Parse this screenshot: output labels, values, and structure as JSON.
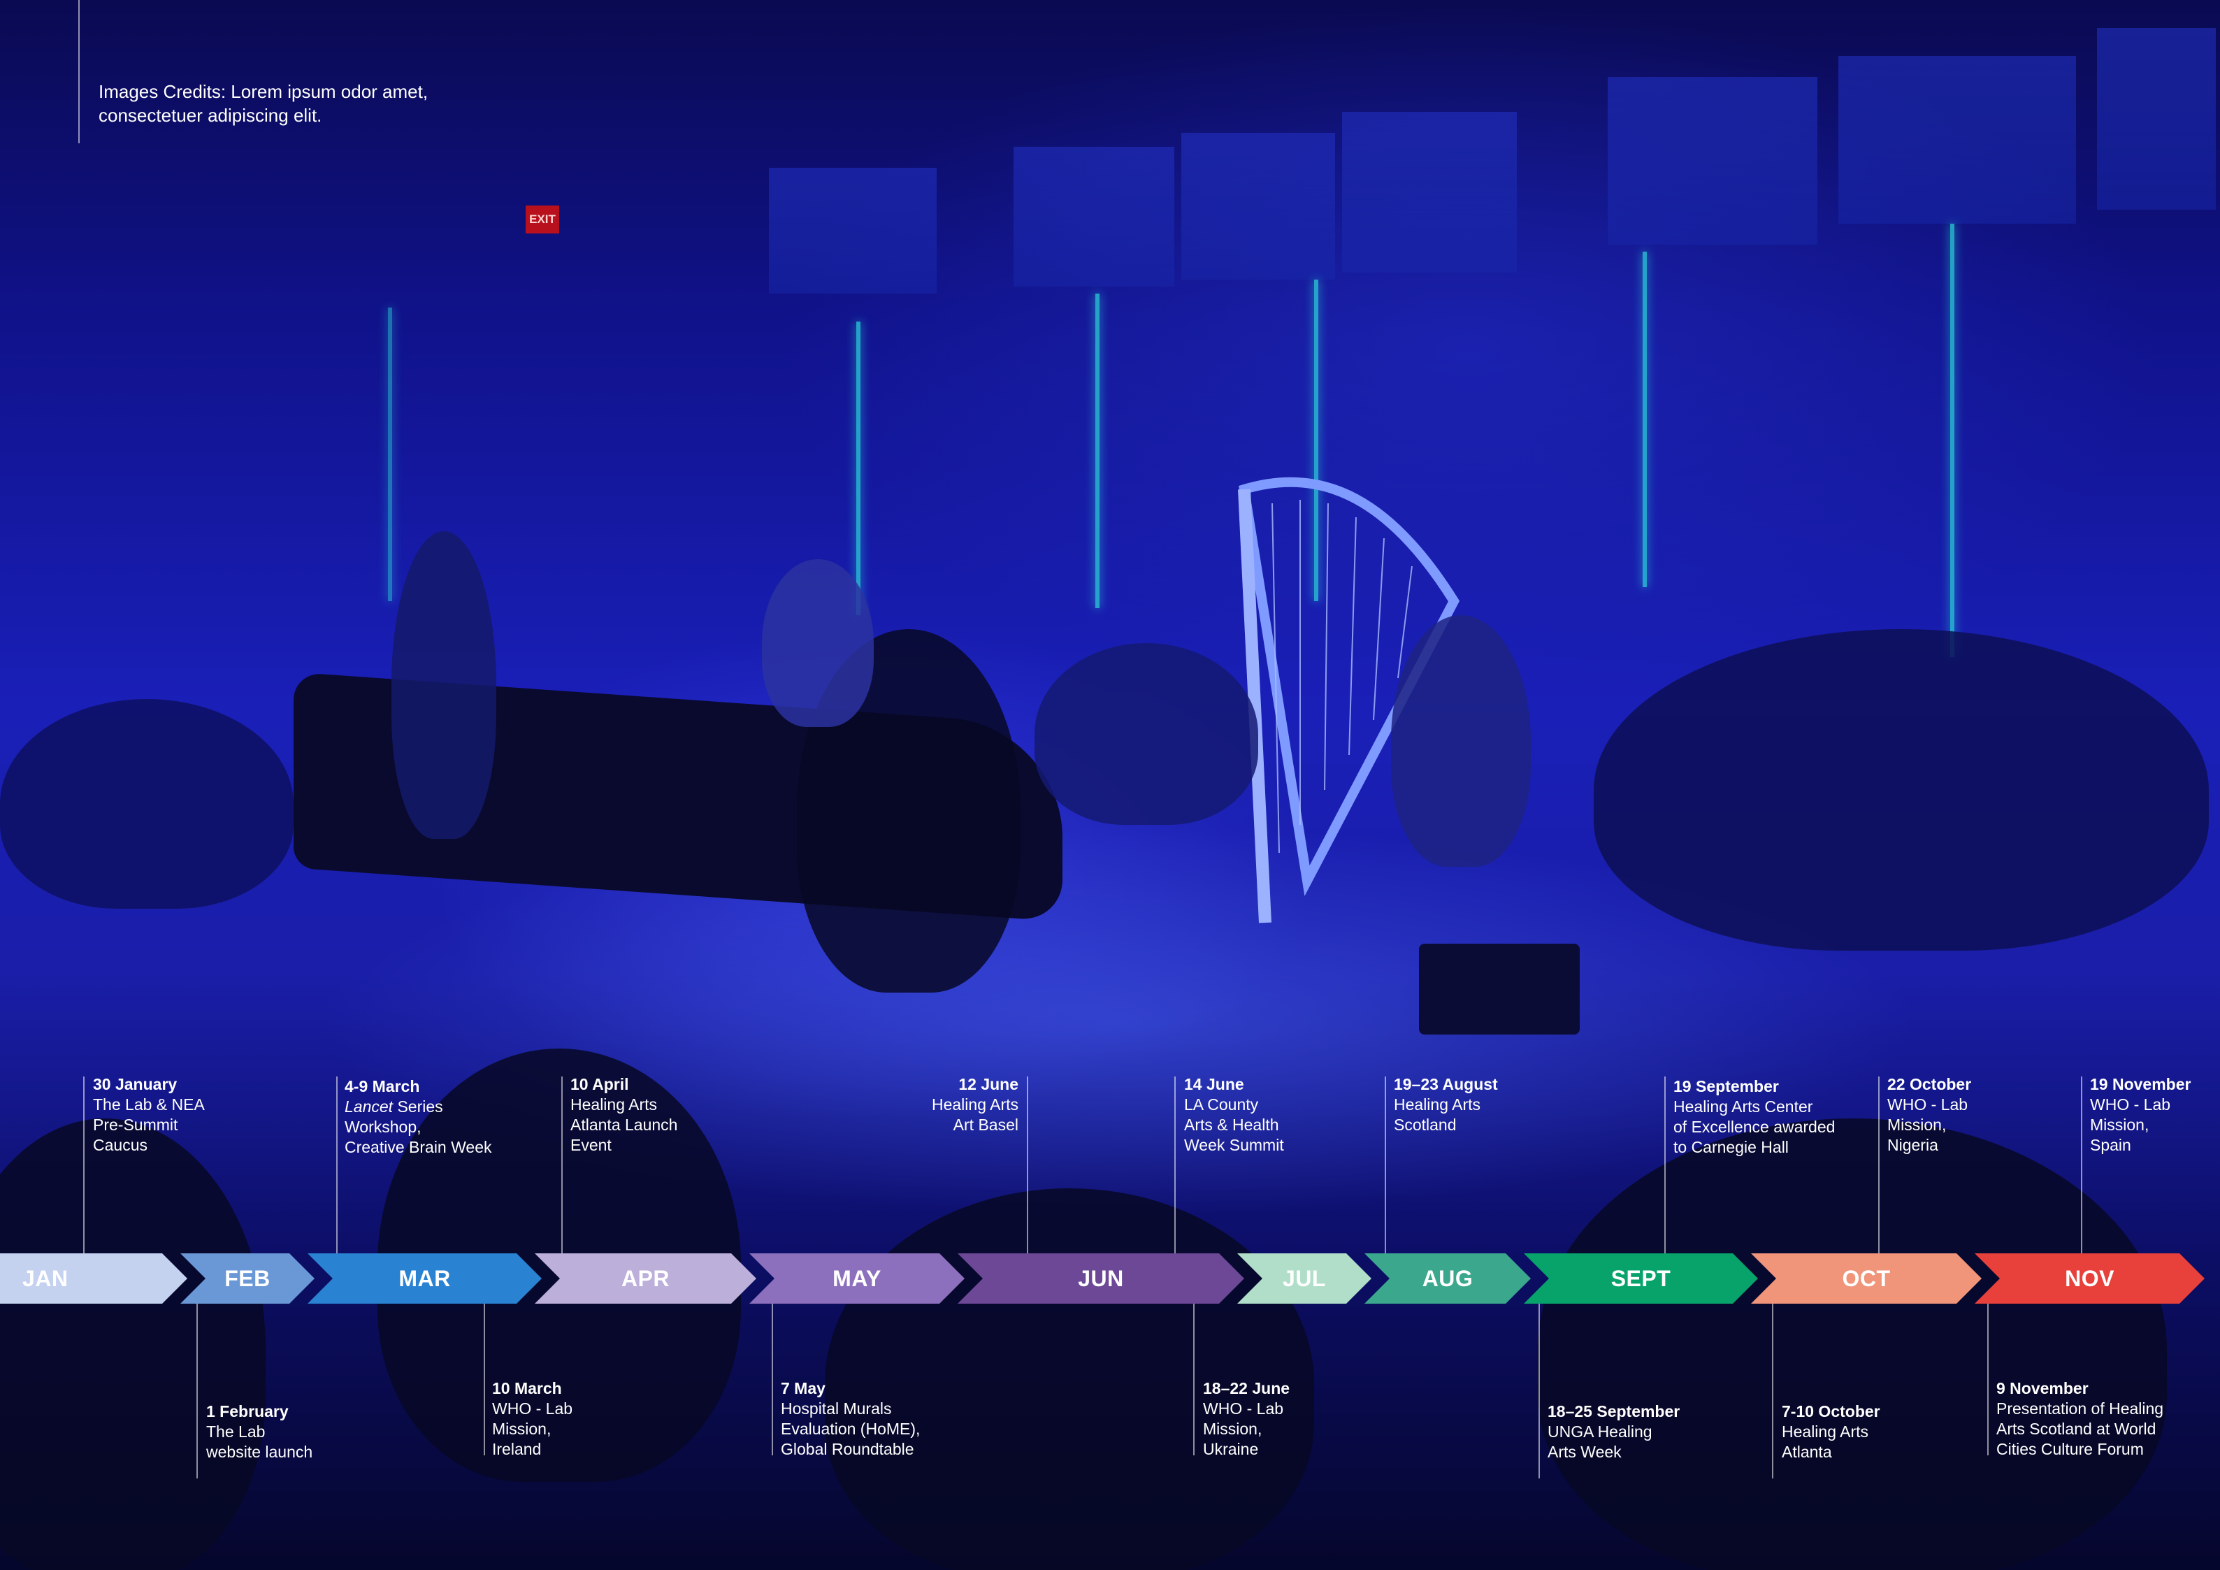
{
  "credit": {
    "text": "Images Credits: Lorem ipsum odor amet, consectetuer adipiscing elit."
  },
  "scene": {
    "exit_sign": "EXIT"
  },
  "colors": {
    "jan": "#c4d1ef",
    "feb": "#6a98d6",
    "mar": "#2a82d2",
    "apr": "#bcb0db",
    "may": "#8d70bd",
    "jun": "#6c4897",
    "jul": "#b0dec8",
    "aug": "#3ba88e",
    "sept": "#08a36b",
    "oct": "#f0957a",
    "nov": "#e8403a"
  },
  "months": [
    {
      "label": "JAN"
    },
    {
      "label": "FEB"
    },
    {
      "label": "MAR"
    },
    {
      "label": "APR"
    },
    {
      "label": "MAY"
    },
    {
      "label": "JUN"
    },
    {
      "label": "JUL"
    },
    {
      "label": "AUG"
    },
    {
      "label": "SEPT"
    },
    {
      "label": "OCT"
    },
    {
      "label": "NOV"
    }
  ],
  "events_above": [
    {
      "date": "30 January",
      "text": "The Lab & NEA\nPre-Summit\nCaucus"
    },
    {
      "date": "4-9 March",
      "italic": "Lancet",
      "text": " Series\nWorkshop,\nCreative Brain Week"
    },
    {
      "date": "10 April",
      "text": "Healing Arts\nAtlanta Launch\nEvent"
    },
    {
      "date": "12 June",
      "text": "Healing Arts\nArt Basel"
    },
    {
      "date": "14 June",
      "text": "LA County\nArts & Health\nWeek Summit"
    },
    {
      "date": "19–23 August",
      "text": "Healing Arts\nScotland"
    },
    {
      "date": "19 September",
      "text": "Healing Arts Center\nof Excellence awarded\nto Carnegie Hall"
    },
    {
      "date": "22 October",
      "text": "WHO - Lab\nMission,\nNigeria"
    },
    {
      "date": "19 November",
      "text": "WHO - Lab\nMission,\nSpain"
    }
  ],
  "events_below": [
    {
      "date": "1 February",
      "text": "The Lab\nwebsite launch"
    },
    {
      "date": "10 March",
      "text": "WHO - Lab\nMission,\nIreland"
    },
    {
      "date": "7 May",
      "text": "Hospital Murals\nEvaluation (HoME),\nGlobal Roundtable"
    },
    {
      "date": "18–22 June",
      "text": "WHO - Lab\nMission,\nUkraine"
    },
    {
      "date": "18–25 September",
      "text": "UNGA Healing\nArts Week"
    },
    {
      "date": "7-10 October",
      "text": "Healing Arts\nAtlanta"
    },
    {
      "date": "9 November",
      "text": "Presentation of Healing\nArts Scotland at World\nCities Culture Forum"
    }
  ]
}
